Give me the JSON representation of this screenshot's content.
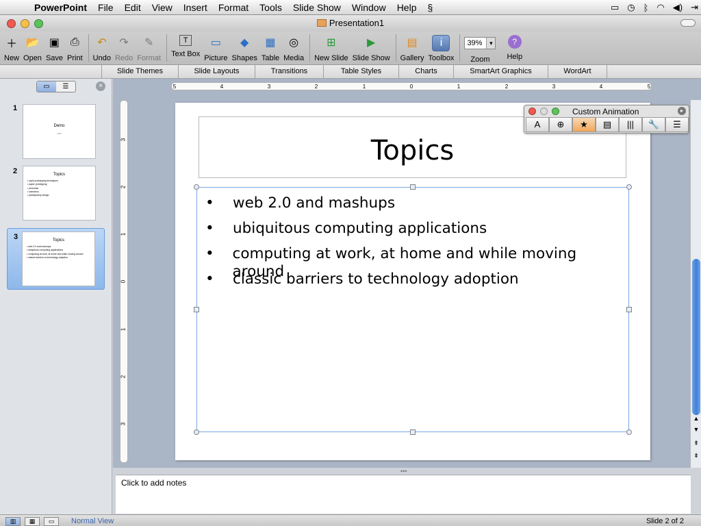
{
  "menubar": {
    "apple": "",
    "app": "PowerPoint",
    "items": [
      "File",
      "Edit",
      "View",
      "Insert",
      "Format",
      "Tools",
      "Slide Show",
      "Window",
      "Help"
    ]
  },
  "window": {
    "title": "Presentation1",
    "colors": {
      "close": "#ee5a50",
      "minimize": "#f5c04a",
      "zoom": "#5ac35a"
    }
  },
  "toolbar": {
    "items": [
      {
        "label": "New",
        "icon": "new-document-icon"
      },
      {
        "label": "Open",
        "icon": "open-folder-icon"
      },
      {
        "label": "Save",
        "icon": "save-disk-icon"
      },
      {
        "label": "Print",
        "icon": "printer-icon"
      },
      {
        "label": "Undo",
        "icon": "undo-arrow-icon"
      },
      {
        "label": "Redo",
        "icon": "redo-arrow-icon",
        "disabled": true
      },
      {
        "label": "Format",
        "icon": "format-brush-icon",
        "disabled": true
      },
      {
        "label": "Text Box",
        "icon": "text-box-icon"
      },
      {
        "label": "Picture",
        "icon": "picture-icon"
      },
      {
        "label": "Shapes",
        "icon": "shapes-icon"
      },
      {
        "label": "Table",
        "icon": "table-icon"
      },
      {
        "label": "Media",
        "icon": "media-icon"
      },
      {
        "label": "New Slide",
        "icon": "new-slide-icon"
      },
      {
        "label": "Slide Show",
        "icon": "slide-show-icon"
      },
      {
        "label": "Gallery",
        "icon": "gallery-icon"
      },
      {
        "label": "Toolbox",
        "icon": "toolbox-icon"
      },
      {
        "label": "Zoom",
        "value": "39%"
      },
      {
        "label": "Help",
        "icon": "help-icon"
      }
    ]
  },
  "ribbon": {
    "tabs": [
      "Slide Themes",
      "Slide Layouts",
      "Transitions",
      "Table Styles",
      "Charts",
      "SmartArt Graphics",
      "WordArt"
    ]
  },
  "slides_panel": {
    "thumbnails": [
      {
        "number": "1",
        "title": "Demo",
        "subtitle": "2008"
      },
      {
        "number": "2",
        "title": "Topics",
        "bullets": [
          "rapid prototyping techniques",
          "paper prototyping",
          "personas",
          "scenarios",
          "participatory design"
        ]
      },
      {
        "number": "3",
        "title": "Topics",
        "bullets": [
          "web 2.0 and mashups",
          "ubiquitous computing applications",
          "computing at work, at home and while moving around",
          "classic barriers to technology adoption"
        ],
        "selected": true
      }
    ]
  },
  "ruler": {
    "horizontal": [
      "5",
      "4",
      "3",
      "2",
      "1",
      "0",
      "1",
      "2",
      "3",
      "4",
      "5"
    ],
    "vertical": [
      "3",
      "2",
      "1",
      "0",
      "1",
      "2",
      "3"
    ]
  },
  "slide": {
    "title": "Topics",
    "bullets": [
      "web 2.0 and mashups",
      "ubiquitous computing applications",
      "computing at work, at home and while moving around",
      "classic barriers to technology adoption"
    ]
  },
  "custom_animation": {
    "title": "Custom Animation",
    "tools": [
      "text-effect-icon",
      "add-picture-icon",
      "star-effect-icon",
      "slides-icon",
      "books-icon",
      "wrench-icon",
      "stack-icon"
    ]
  },
  "notes": {
    "placeholder": "Click to add notes"
  },
  "status": {
    "view": "Normal View",
    "slide": "Slide 2 of 2"
  }
}
